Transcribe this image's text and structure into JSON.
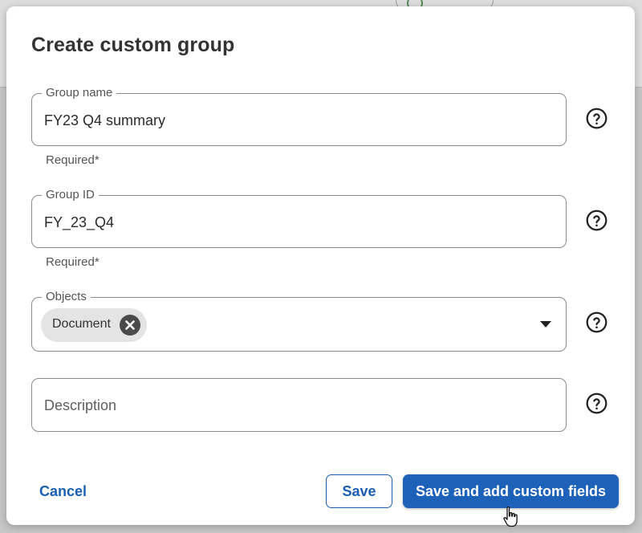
{
  "dialog": {
    "title": "Create custom group"
  },
  "fields": {
    "group_name": {
      "label": "Group name",
      "value": "FY23 Q4 summary",
      "helper": "Required*"
    },
    "group_id": {
      "label": "Group ID",
      "value": "FY_23_Q4",
      "helper": "Required*"
    },
    "objects": {
      "label": "Objects",
      "chips": [
        "Document"
      ]
    },
    "description": {
      "placeholder": "Description"
    }
  },
  "actions": {
    "cancel_label": "Cancel",
    "save_label": "Save",
    "save_and_add_label": "Save and add custom fields"
  },
  "colors": {
    "primary": "#1e61b8",
    "link": "#1a5fb4",
    "chip_bg": "#e4e4e4",
    "chip_remove": "#4a4a4a"
  },
  "icons": {
    "help": "question-circle-icon",
    "chip_remove": "close-circle-icon",
    "dropdown": "caret-down-icon",
    "cursor": "hand-pointer-cursor"
  }
}
